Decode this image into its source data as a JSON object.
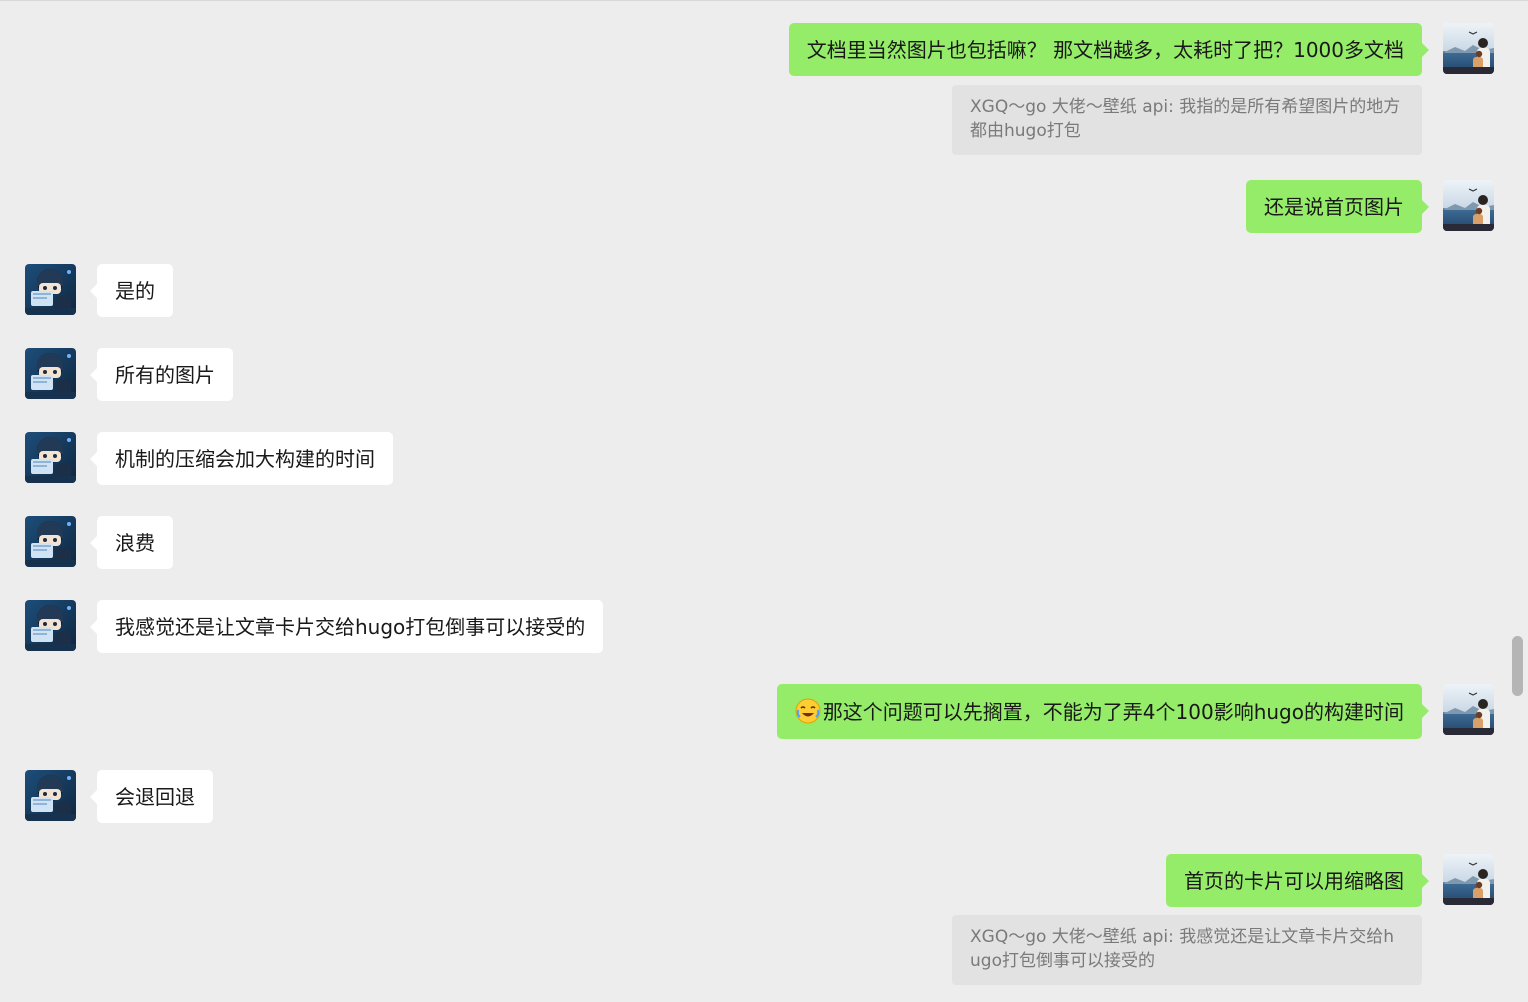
{
  "messages": [
    {
      "side": "me",
      "text": "文档里当然图片也包括嘛？ 那文档越多，太耗时了把？1000多文档",
      "quote": "XGQ～go 大佬～壁纸 api: 我指的是所有希望图片的地方都由hugo打包"
    },
    {
      "side": "me",
      "text": "还是说首页图片"
    },
    {
      "side": "other",
      "text": "是的"
    },
    {
      "side": "other",
      "text": "所有的图片"
    },
    {
      "side": "other",
      "text": "机制的压缩会加大构建的时间"
    },
    {
      "side": "other",
      "text": "浪费"
    },
    {
      "side": "other",
      "text": "我感觉还是让文章卡片交给hugo打包倒事可以接受的"
    },
    {
      "side": "me",
      "emoji": "laughing-crying-emoji",
      "text": "那这个问题可以先搁置，不能为了弄4个100影响hugo的构建时间"
    },
    {
      "side": "other",
      "text": "会退回退"
    },
    {
      "side": "me",
      "text": "首页的卡片可以用缩略图",
      "quote": "XGQ～go 大佬～壁纸 api: 我感觉还是让文章卡片交给hugo打包倒事可以接受的"
    }
  ],
  "colors": {
    "background": "#ededed",
    "my_bubble": "#95ec69",
    "other_bubble": "#ffffff",
    "quote_bg": "#e2e2e2",
    "quote_text": "#7a7a7a"
  }
}
